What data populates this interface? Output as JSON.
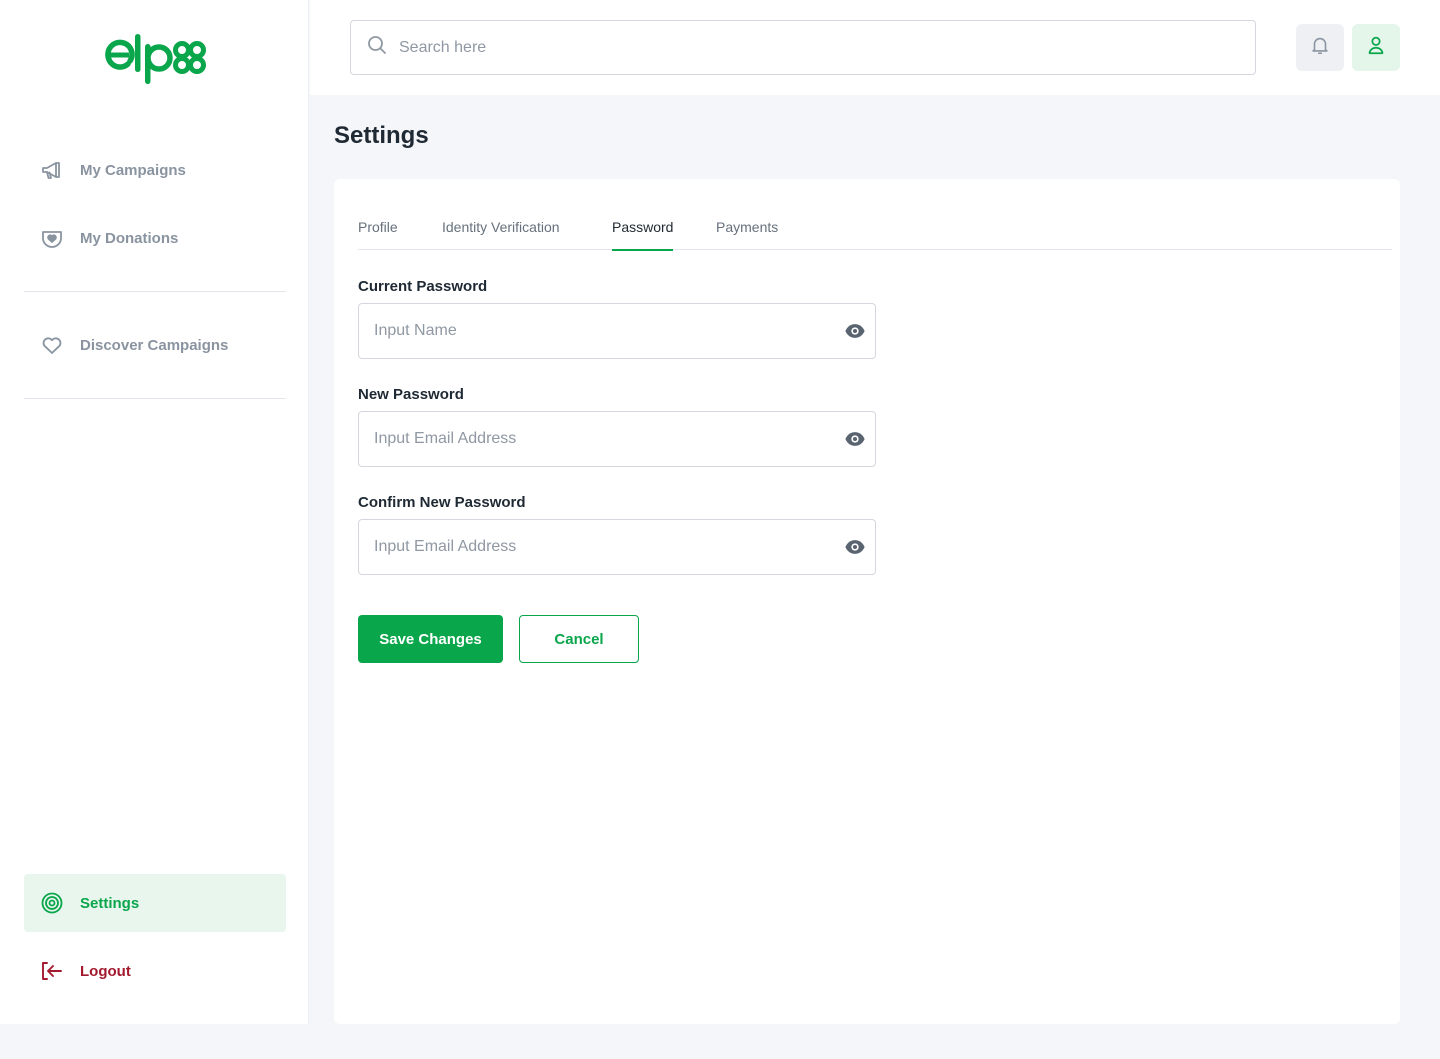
{
  "brand": {
    "name": "elpx",
    "accent": "#0aa64b"
  },
  "sidebar": {
    "items": [
      {
        "label": "My Campaigns",
        "icon": "megaphone-icon"
      },
      {
        "label": "My Donations",
        "icon": "donation-heart-icon"
      },
      {
        "label": "Discover Campaigns",
        "icon": "heart-icon"
      }
    ],
    "settings": {
      "label": "Settings",
      "icon": "gear-icon",
      "active": true
    },
    "logout": {
      "label": "Logout",
      "icon": "logout-icon",
      "color": "#a3192e"
    }
  },
  "header": {
    "search_placeholder": "Search here",
    "notifications_icon": "bell-icon",
    "profile_icon": "user-icon"
  },
  "page": {
    "title": "Settings",
    "tabs": [
      {
        "label": "Profile"
      },
      {
        "label": "Identity Verification"
      },
      {
        "label": "Password",
        "active": true
      },
      {
        "label": "Payments"
      }
    ],
    "form": {
      "current_password": {
        "label": "Current Password",
        "placeholder": "Input Name",
        "value": ""
      },
      "new_password": {
        "label": "New Password",
        "placeholder": "Input Email Address",
        "value": ""
      },
      "confirm_password": {
        "label": "Confirm New Password",
        "placeholder": "Input Email Address",
        "value": ""
      }
    },
    "actions": {
      "save_label": "Save Changes",
      "cancel_label": "Cancel"
    }
  }
}
